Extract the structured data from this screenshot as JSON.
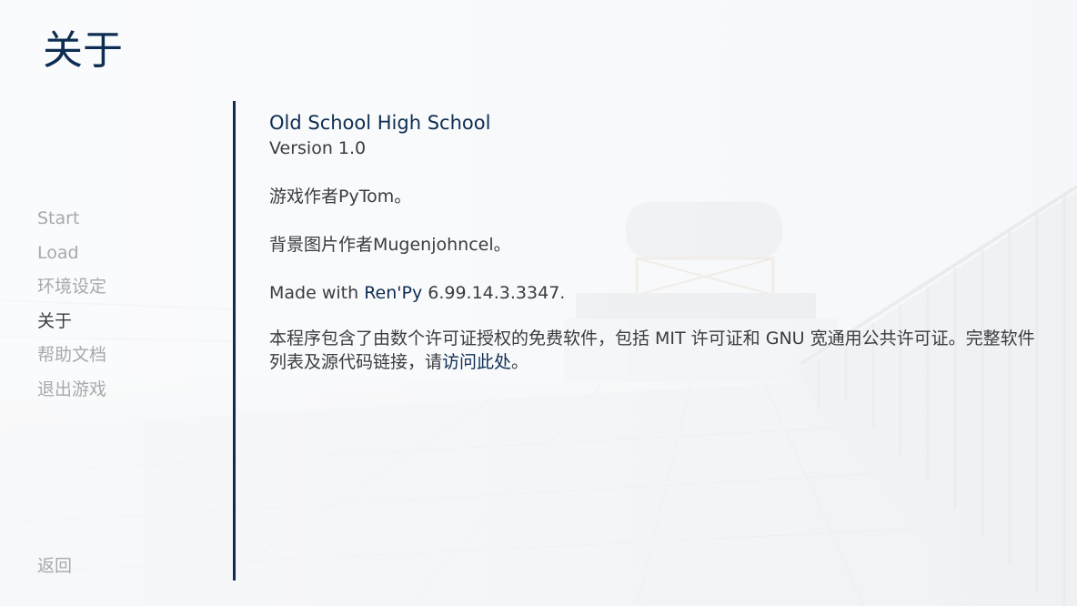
{
  "screen": {
    "title": "关于"
  },
  "nav": {
    "items": [
      {
        "label": "Start"
      },
      {
        "label": "Load"
      },
      {
        "label": "环境设定"
      },
      {
        "label": "关于",
        "active": true
      },
      {
        "label": "帮助文档"
      },
      {
        "label": "退出游戏"
      }
    ],
    "back_label": "返回"
  },
  "about": {
    "game_name": "Old School High School",
    "version": "Version 1.0",
    "credit_author": "游戏作者PyTom。",
    "credit_background": "背景图片作者Mugenjohncel。",
    "made_with_prefix": "Made with ",
    "renpy_link": "Ren'Py",
    "renpy_version": " 6.99.14.3.3347.",
    "license_text": "本程序包含了由数个许可证授权的免费软件，包括 MIT 许可证和 GNU 宽通用公共许可证。完整软件列表及源代码链接，请",
    "license_link": "访问此处",
    "license_end": "。"
  },
  "colors": {
    "accent": "#0e2d52",
    "text": "#3a3c3f",
    "nav_inactive": "#a7a9ac"
  }
}
